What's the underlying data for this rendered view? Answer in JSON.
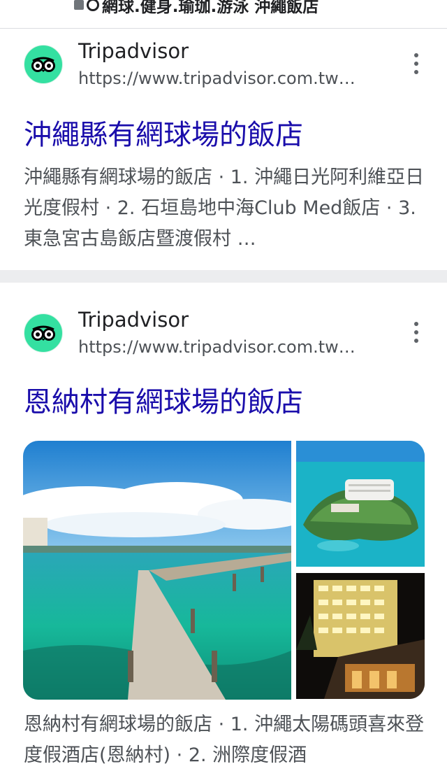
{
  "search_bar": {
    "query": "網球.健身.瑜珈.游泳 沖繩飯店"
  },
  "results": [
    {
      "source": "Tripadvisor",
      "url": "https://www.tripadvisor.com.tw…",
      "title": "沖繩縣有網球場的飯店",
      "snippet": "沖繩縣有網球場的飯店 · 1. 沖繩日光阿利維亞日光度假村 · 2. 石垣島地中海Club Med飯店 · 3. 東急宮古島飯店暨渡假村 …"
    },
    {
      "source": "Tripadvisor",
      "url": "https://www.tripadvisor.com.tw…",
      "title": "恩納村有網球場的飯店",
      "snippet": "恩納村有網球場的飯店 · 1. 沖繩太陽碼頭喜來登度假酒店(恩納村) · 2. 洲際度假酒"
    }
  ],
  "colors": {
    "link": "#1a0dab",
    "favicon": "#34e0a1",
    "divider": "#ecedef"
  }
}
